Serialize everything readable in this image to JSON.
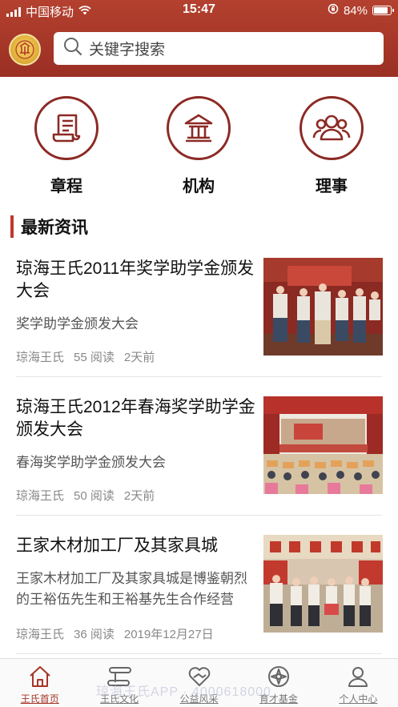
{
  "status_bar": {
    "carrier": "中国移动",
    "time": "15:47",
    "battery": "84%",
    "battery_level": 0.84
  },
  "search": {
    "placeholder": "关键字搜索"
  },
  "quick_nav": [
    {
      "label": "章程",
      "icon": "document-icon"
    },
    {
      "label": "机构",
      "icon": "building-icon"
    },
    {
      "label": "理事",
      "icon": "people-icon"
    }
  ],
  "section": {
    "title": "最新资讯"
  },
  "news": [
    {
      "title": "琼海王氏2011年奖学助学金颁发大会",
      "summary": "奖学助学金颁发大会",
      "source": "琼海王氏",
      "reads": "55 阅读",
      "time": "2天前"
    },
    {
      "title": "琼海王氏2012年春海奖学助学金颁发大会",
      "summary": "春海奖学助学金颁发大会",
      "source": "琼海王氏",
      "reads": "50 阅读",
      "time": "2天前"
    },
    {
      "title": "王家木材加工厂及其家具城",
      "summary": "王家木材加工厂及其家具城是博鉴朝烈的王裕伍先生和王裕基先生合作经营",
      "source": "琼海王氏",
      "reads": "36 阅读",
      "time": "2019年12月27日"
    }
  ],
  "tabs": [
    {
      "label": "王氏首页",
      "icon": "home-icon",
      "active": true
    },
    {
      "label": "王氏文化",
      "icon": "scroll-icon",
      "active": false
    },
    {
      "label": "公益风采",
      "icon": "heart-hands-icon",
      "active": false
    },
    {
      "label": "育才基金",
      "icon": "compass-badge-icon",
      "active": false
    },
    {
      "label": "个人中心",
      "icon": "user-icon",
      "active": false
    }
  ],
  "watermark": "琼海王氏APP · 4000618000",
  "colors": {
    "brand": "#a53628",
    "accent_bar": "#c0392b",
    "icon_ring": "#8c2a25"
  }
}
